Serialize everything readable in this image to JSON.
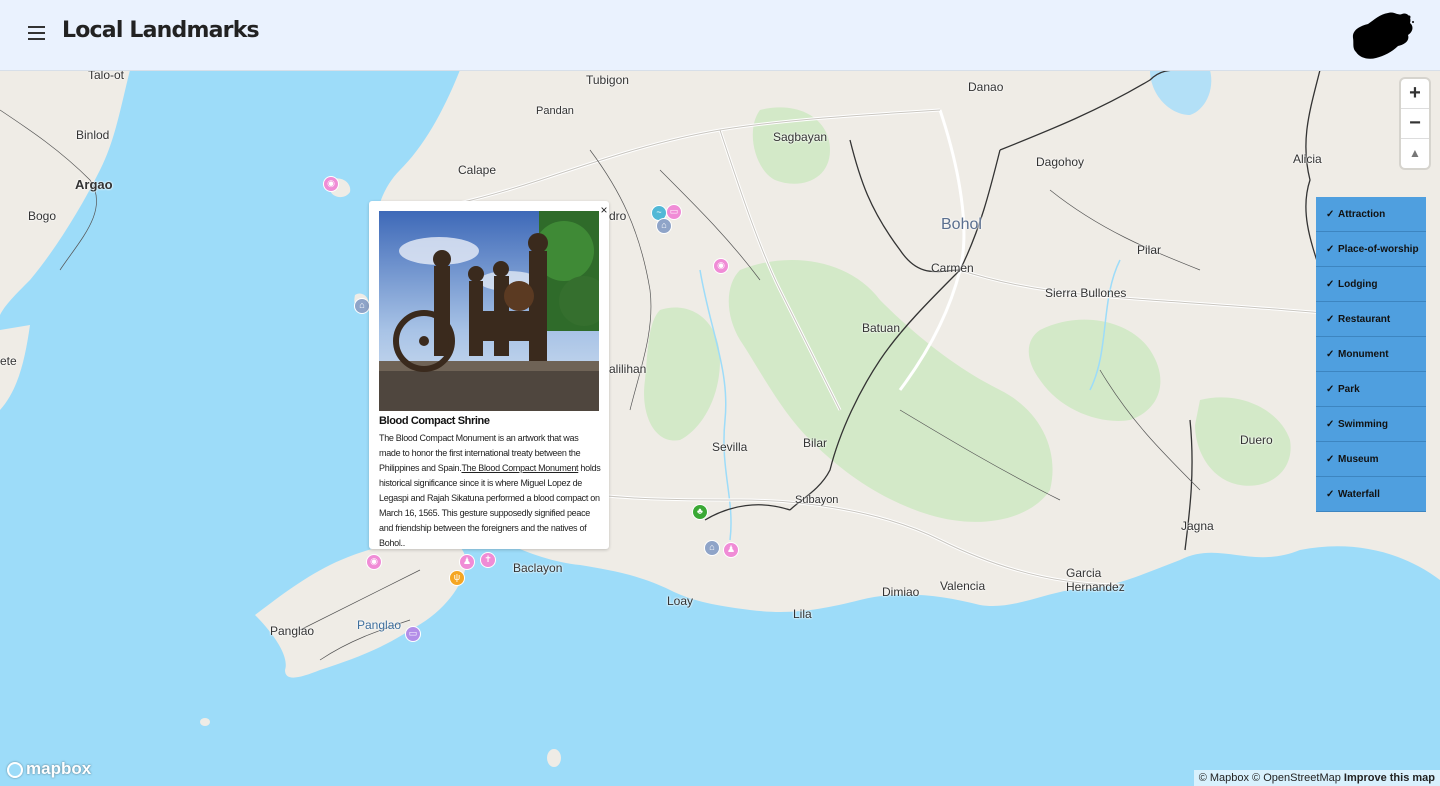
{
  "header": {
    "title": "Local Landmarks",
    "menu_icon": "hamburger-icon",
    "logo_icon": "bohol-island-icon"
  },
  "map": {
    "places": [
      {
        "name": "Talo-ot"
      },
      {
        "name": "Binlod"
      },
      {
        "name": "Argao"
      },
      {
        "name": "Bogo"
      },
      {
        "name": "ete"
      },
      {
        "name": "Tubigon"
      },
      {
        "name": "Pandan"
      },
      {
        "name": "Calape"
      },
      {
        "name": "dro"
      },
      {
        "name": "alilihan"
      },
      {
        "name": "Sagbayan"
      },
      {
        "name": "Danao"
      },
      {
        "name": "Dagohoy"
      },
      {
        "name": "Alicia"
      },
      {
        "name": "Bohol"
      },
      {
        "name": "Carmen"
      },
      {
        "name": "Pilar"
      },
      {
        "name": "Sierra Bullones"
      },
      {
        "name": "Batuan"
      },
      {
        "name": "Sevilla"
      },
      {
        "name": "Bilar"
      },
      {
        "name": "Subayon"
      },
      {
        "name": "Duero"
      },
      {
        "name": "Jagna"
      },
      {
        "name": "Baclayon"
      },
      {
        "name": "Loay"
      },
      {
        "name": "Lila"
      },
      {
        "name": "Dimiao"
      },
      {
        "name": "Valencia"
      },
      {
        "name": "Garcia Hernandez"
      },
      {
        "name": "Panglao"
      },
      {
        "name": "Panglao"
      }
    ],
    "markers": [
      {
        "type": "attraction",
        "icon": "camera-icon",
        "color": "#f08cd6"
      },
      {
        "type": "museum",
        "icon": "museum-icon",
        "color": "#8fa4c8"
      },
      {
        "type": "swimming",
        "icon": "swimming-icon",
        "color": "#52b8d6"
      },
      {
        "type": "lodging",
        "icon": "bed-icon",
        "color": "#f08cd6"
      },
      {
        "type": "museum",
        "icon": "museum-icon",
        "color": "#8fa4c8"
      },
      {
        "type": "attraction",
        "icon": "camera-icon",
        "color": "#f08cd6"
      },
      {
        "type": "attraction",
        "icon": "camera-icon",
        "color": "#f08cd6"
      },
      {
        "type": "monument",
        "icon": "monument-icon",
        "color": "#f08cd6"
      },
      {
        "type": "place-of-worship",
        "icon": "church-icon",
        "color": "#f08cd6"
      },
      {
        "type": "restaurant",
        "icon": "restaurant-icon",
        "color": "#f5a623"
      },
      {
        "type": "lodging",
        "icon": "bed-icon",
        "color": "#b38ee8"
      },
      {
        "type": "park",
        "icon": "tree-icon",
        "color": "#3aa835"
      },
      {
        "type": "museum",
        "icon": "museum-icon",
        "color": "#8fa4c8"
      },
      {
        "type": "monument",
        "icon": "monument-icon",
        "color": "#f08cd6"
      }
    ]
  },
  "zoom": {
    "in_label": "+",
    "out_label": "−",
    "compass_icon": "compass-icon"
  },
  "filters": [
    {
      "label": "Attraction",
      "checked": true
    },
    {
      "label": "Place-of-worship",
      "checked": true
    },
    {
      "label": "Lodging",
      "checked": true
    },
    {
      "label": "Restaurant",
      "checked": true
    },
    {
      "label": "Monument",
      "checked": true
    },
    {
      "label": "Park",
      "checked": true
    },
    {
      "label": "Swimming",
      "checked": true
    },
    {
      "label": "Museum",
      "checked": true
    },
    {
      "label": "Waterfall",
      "checked": true
    }
  ],
  "popup": {
    "close_label": "×",
    "title": "Blood Compact Shrine",
    "desc_part1": "The Blood Compact Monument is an artwork that was made to honor the first international treaty between the Philippines and Spain.",
    "desc_link": "The Blood Compact Monument",
    "desc_part2": " holds historical significance since it is where Miguel Lopez de Legaspi and Rajah Sikatuna performed a blood compact on March 16, 1565. This gesture supposedly signified peace and friendship between the foreigners and the natives of Bohol.."
  },
  "footer": {
    "mapbox_logo": "mapbox",
    "attribution": "© Mapbox © OpenStreetMap",
    "improve_link": "Improve this map"
  },
  "colors": {
    "water": "#9ddcf9",
    "land": "#efece6",
    "park": "#d3e9c8",
    "filter_bg": "#4f9fdf",
    "header_bg": "#eaf2fe"
  }
}
